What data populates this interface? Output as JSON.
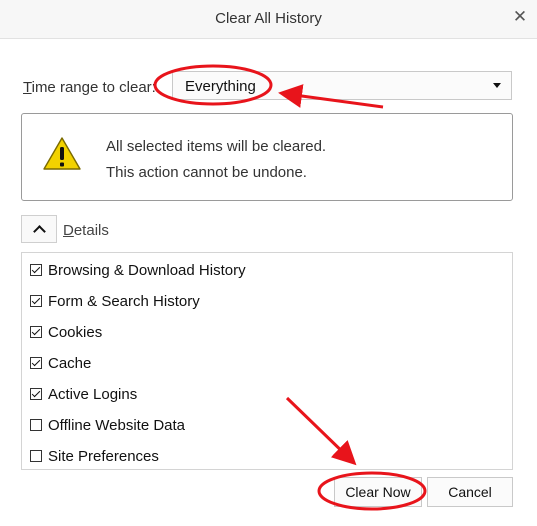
{
  "window": {
    "title": "Clear All History",
    "close_glyph": "✕"
  },
  "time_range": {
    "label_prefix": "T",
    "label_rest": "ime range to clear:",
    "selected": "Everything"
  },
  "warning": {
    "icon": "warning-triangle-icon",
    "line1": "All selected items will be cleared.",
    "line2": "This action cannot be undone."
  },
  "details": {
    "label_prefix": "D",
    "label_rest": "etails",
    "expanded": true,
    "items": [
      {
        "label": "Browsing & Download History",
        "checked": true
      },
      {
        "label": "Form & Search History",
        "checked": true
      },
      {
        "label": "Cookies",
        "checked": true
      },
      {
        "label": "Cache",
        "checked": true
      },
      {
        "label": "Active Logins",
        "checked": true
      },
      {
        "label": "Offline Website Data",
        "checked": false
      },
      {
        "label": "Site Preferences",
        "checked": false
      }
    ]
  },
  "buttons": {
    "clear_now": "Clear Now",
    "cancel": "Cancel"
  },
  "colors": {
    "annotation_red": "#e8141b",
    "warning_yellow": "#f2d200"
  }
}
